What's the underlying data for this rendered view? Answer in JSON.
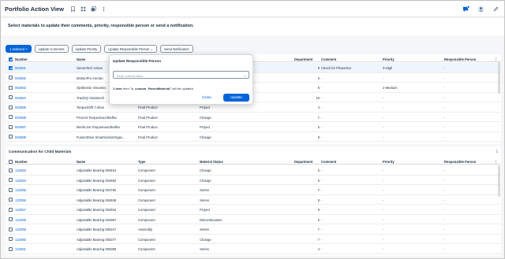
{
  "app": {
    "title": "Portfolio Action View"
  },
  "header": {
    "instruction": "Select materials to update their comments, priority, responsible person or send a notification."
  },
  "toolbar": {
    "selected_label": "1 selected",
    "actions": [
      "Update Comment",
      "Update Priority",
      "Update Responsible Person",
      "Send Notification"
    ]
  },
  "table1": {
    "columns": [
      "Number",
      "Name",
      "Department",
      "Comment",
      "Priority",
      "Responsible Person"
    ],
    "rows": [
      {
        "number": "002581",
        "name": "SenseTech Vision",
        "type": "",
        "status": "",
        "dept": "9",
        "comment": "Check for PhaseOut",
        "priority": "3-High",
        "person": "-",
        "selected": true
      },
      {
        "number": "002582",
        "name": "MotionPro Aerotec",
        "type": "",
        "status": "",
        "dept": "6",
        "comment": "-",
        "priority": "-",
        "person": "-",
        "selected": false
      },
      {
        "number": "002583",
        "name": "OptiSense Visiontec",
        "type": "",
        "status": "",
        "dept": "8",
        "comment": "-",
        "priority": "2-Medium",
        "person": "-",
        "selected": false
      },
      {
        "number": "002584",
        "name": "TrackIQ Visiontech",
        "type": "",
        "status": "",
        "dept": "10",
        "comment": "-",
        "priority": "-",
        "person": "-",
        "selected": false
      },
      {
        "number": "002585",
        "name": "TorqueShift 7-drive",
        "type": "Final Product",
        "status": "Project",
        "dept": "4",
        "comment": "-",
        "priority": "-",
        "person": "-",
        "selected": false
      },
      {
        "number": "002586",
        "name": "ProUnit TorquemaxUltraflex",
        "type": "Final Product",
        "status": "Change",
        "dept": "7",
        "comment": "-",
        "priority": "-",
        "person": "-",
        "selected": false
      },
      {
        "number": "002587",
        "name": "MechLine TorquemaxUltraflex",
        "type": "Final Product",
        "status": "Project",
        "dept": "6",
        "comment": "-",
        "priority": "-",
        "person": "-",
        "selected": false
      },
      {
        "number": "002588",
        "name": "FusionDrive SmartmotionGigac...",
        "type": "Final Product",
        "status": "Change",
        "dept": "8",
        "comment": "-",
        "priority": "-",
        "person": "-",
        "selected": false
      }
    ]
  },
  "popover": {
    "title": "Update Responsible Person",
    "placeholder": "Keep current value",
    "info_prefix": "1 item",
    "info_mid": " from ",
    "info_entity": "\"c_custom_ParentMaterial\"",
    "info_suffix": " will be updated",
    "close_label": "Close",
    "update_label": "Update"
  },
  "table2": {
    "title": "Communication for Child Materials",
    "columns": [
      "Number",
      "Name",
      "Type",
      "Material Status",
      "Department",
      "Comment",
      "Priority",
      "Responsible Person"
    ],
    "rows": [
      {
        "number": "122053",
        "name": "Adjustable Bearing 004524",
        "type": "Component",
        "status": "Change",
        "dept": "5",
        "comment": "-",
        "priority": "-",
        "person": "-"
      },
      {
        "number": "122054",
        "name": "Adjustable Bearing 004650",
        "type": "Component",
        "status": "Change",
        "dept": "6",
        "comment": "-",
        "priority": "-",
        "person": "-"
      },
      {
        "number": "122055",
        "name": "Adjustable Bearing 004780",
        "type": "Component",
        "status": "Series",
        "dept": "7",
        "comment": "-",
        "priority": "-",
        "person": "-"
      },
      {
        "number": "122056",
        "name": "Adjustable Bearing 004848",
        "type": "Component",
        "status": "Series",
        "dept": "9",
        "comment": "-",
        "priority": "-",
        "person": "-"
      },
      {
        "number": "122057",
        "name": "Adjustable Bearing 004944",
        "type": "Component",
        "status": "Project",
        "dept": "8",
        "comment": "-",
        "priority": "-",
        "person": "-"
      },
      {
        "number": "122058",
        "name": "Adjustable Bearing 004987",
        "type": "Component",
        "status": "Discontinuation",
        "dept": "6",
        "comment": "-",
        "priority": "-",
        "person": "-"
      },
      {
        "number": "122059",
        "name": "Adjustable Bearing 005107",
        "type": "Assembly",
        "status": "Series",
        "dept": "7",
        "comment": "-",
        "priority": "-",
        "person": "-"
      },
      {
        "number": "122060",
        "name": "Adjustable Bearing 005377",
        "type": "Component",
        "status": "Change",
        "dept": "7",
        "comment": "-",
        "priority": "-",
        "person": "-"
      },
      {
        "number": "122061",
        "name": "Adjustable Bearing 005399",
        "type": "Component",
        "status": "Series",
        "dept": "4",
        "comment": "-",
        "priority": "-",
        "person": "-"
      }
    ]
  },
  "colors": {
    "accent": "#0064d9",
    "text": "#1d2d3e",
    "link": "#0064d9",
    "background": "#f5f6f7"
  },
  "icons": [
    "bookmark-icon",
    "grid-icon",
    "share-icon",
    "more-icon",
    "notification-icon",
    "avatar-icon",
    "edit-icon"
  ]
}
